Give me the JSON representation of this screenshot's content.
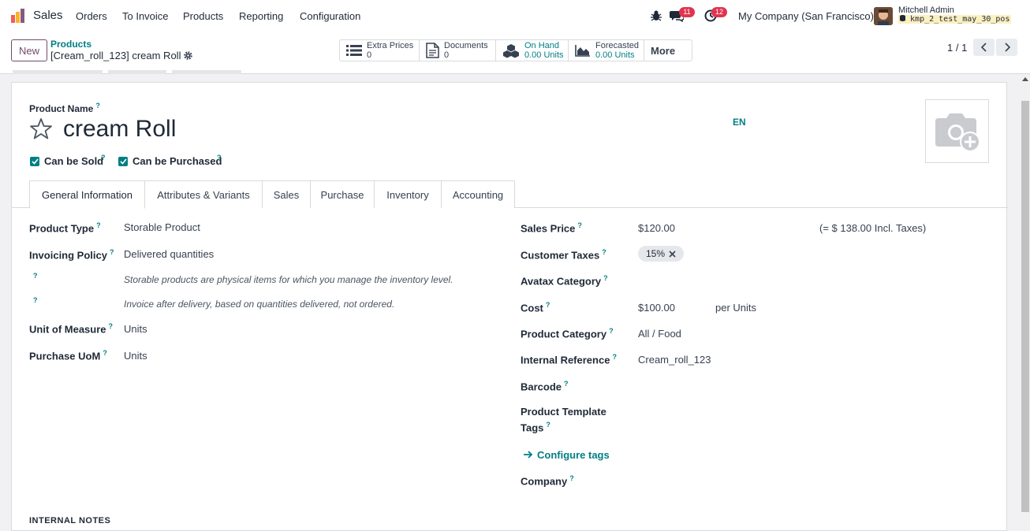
{
  "app": {
    "name": "Sales"
  },
  "nav": {
    "orders": "Orders",
    "to_invoice": "To Invoice",
    "products": "Products",
    "reporting": "Reporting",
    "configuration": "Configuration"
  },
  "systray": {
    "messages_count": "11",
    "activities_count": "12",
    "company": "My Company (San Francisco)",
    "user_name": "Mitchell Admin",
    "database": "kmp_2_test_may_30_pos"
  },
  "control": {
    "new_label": "New",
    "breadcrumb_parent": "Products",
    "breadcrumb_current": "[Cream_roll_123] cream Roll",
    "smart_buttons": [
      {
        "label": "Extra Prices",
        "value": "0",
        "icon": "list-icon"
      },
      {
        "label": "Documents",
        "value": "0",
        "icon": "document-icon"
      },
      {
        "label": "On Hand",
        "value": "0.00 Units",
        "icon": "cubes-icon"
      },
      {
        "label": "Forecasted",
        "value": "0.00 Units",
        "icon": "area-chart-icon"
      }
    ],
    "more_label": "More",
    "pager": "1 / 1"
  },
  "form": {
    "product_name_label": "Product Name",
    "product_name": "cream Roll",
    "lang": "EN",
    "can_be_sold": "Can be Sold",
    "can_be_purchased": "Can be Purchased",
    "tabs": [
      "General Information",
      "Attributes & Variants",
      "Sales",
      "Purchase",
      "Inventory",
      "Accounting"
    ],
    "left": {
      "product_type_label": "Product Type",
      "product_type": "Storable Product",
      "invoicing_policy_label": "Invoicing Policy",
      "invoicing_policy": "Delivered quantities",
      "help_type": "Storable products are physical items for which you manage the inventory level.",
      "help_invoice": "Invoice after delivery, based on quantities delivered, not ordered.",
      "uom_label": "Unit of Measure",
      "uom": "Units",
      "purchase_uom_label": "Purchase UoM",
      "purchase_uom": "Units"
    },
    "right": {
      "sales_price_label": "Sales Price",
      "sales_price": "$120.00",
      "incl_taxes": "(= $ 138.00 Incl. Taxes)",
      "customer_taxes_label": "Customer Taxes",
      "tax_tag": "15%",
      "avatax_label": "Avatax Category",
      "cost_label": "Cost",
      "cost": "$100.00",
      "cost_unit": "per Units",
      "category_label": "Product Category",
      "category": "All / Food",
      "internal_ref_label": "Internal Reference",
      "internal_ref": "Cream_roll_123",
      "barcode_label": "Barcode",
      "template_tags_label_1": "Product Template",
      "template_tags_label_2": "Tags",
      "configure_tags": "Configure tags",
      "company_label": "Company"
    },
    "internal_notes": "INTERNAL NOTES"
  },
  "colors": {
    "brand": "#714b67",
    "accent": "#017e84",
    "badge": "#e0344f"
  }
}
